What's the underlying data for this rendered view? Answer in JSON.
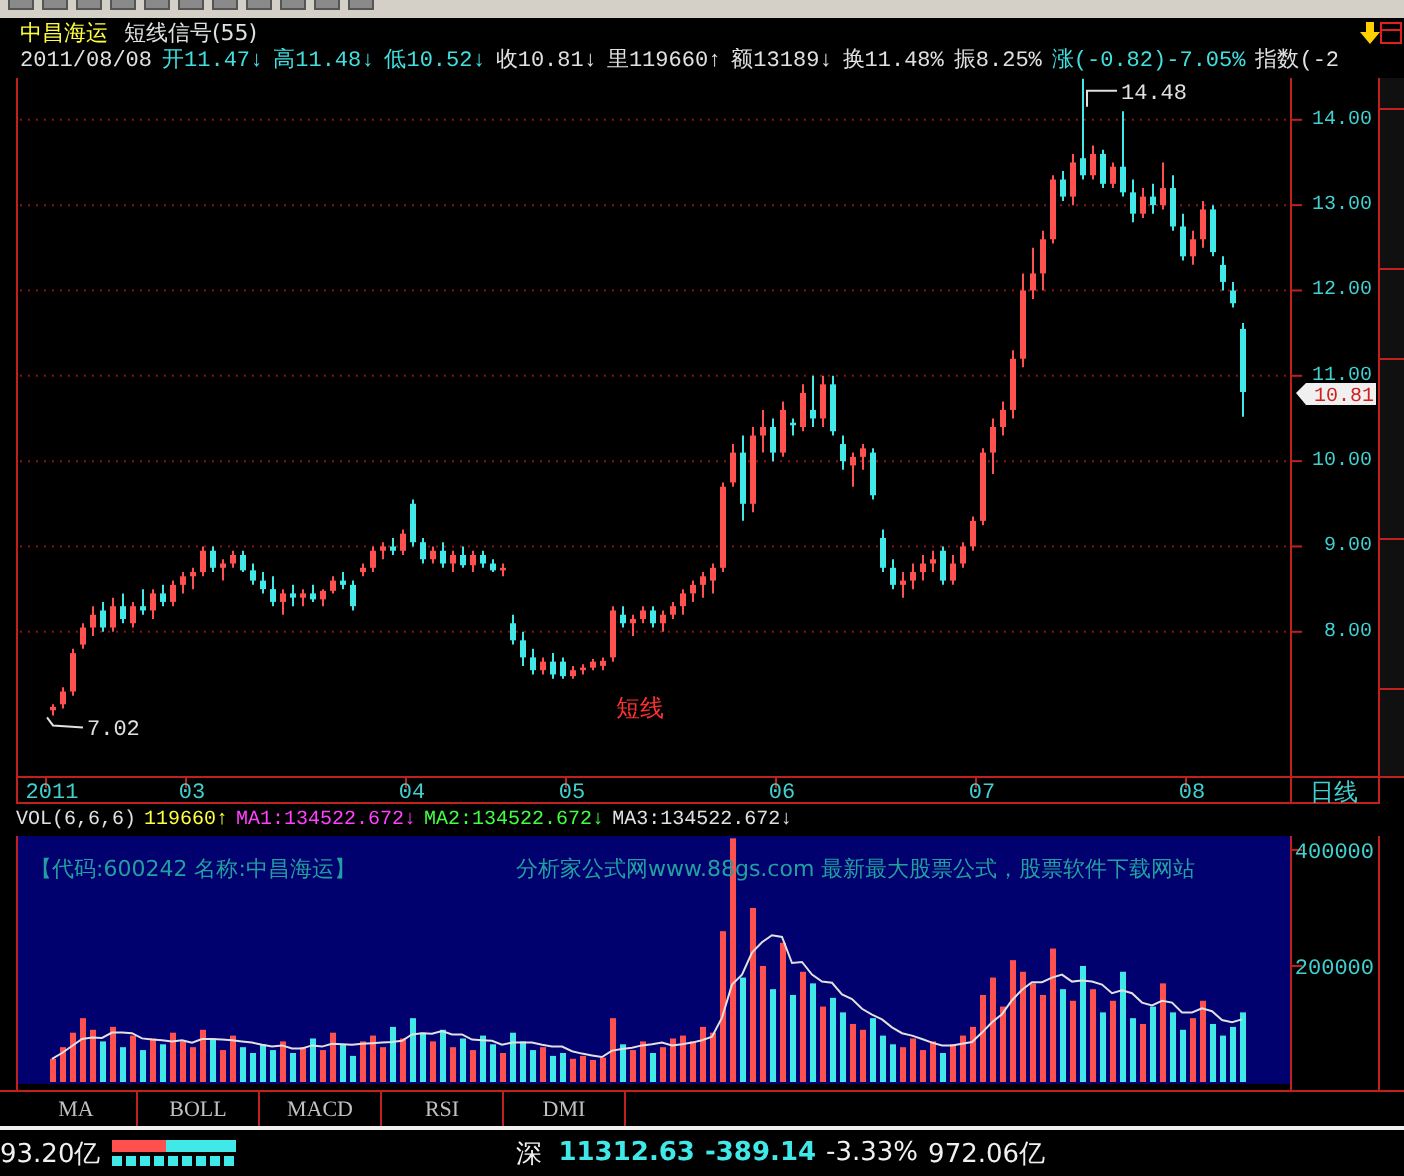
{
  "header": {
    "stock_name": "中昌海运",
    "indicator": "短线信号(55)"
  },
  "quote_line": [
    {
      "text": "2011/08/08",
      "color": "#e0e0e0"
    },
    {
      "text": "开11.47↓",
      "color": "#40e0e0"
    },
    {
      "text": "高11.48↓",
      "color": "#40e0e0"
    },
    {
      "text": "低10.52↓",
      "color": "#40e0e0"
    },
    {
      "text": "收10.81↓",
      "color": "#e0e0e0"
    },
    {
      "text": "里119660↑",
      "color": "#e0e0e0"
    },
    {
      "text": "额13189↓",
      "color": "#e0e0e0"
    },
    {
      "text": "换11.48%",
      "color": "#e0e0e0"
    },
    {
      "text": "振8.25%",
      "color": "#e0e0e0"
    },
    {
      "text": "涨(-0.82)-7.05%",
      "color": "#40e0e0"
    },
    {
      "text": "指数(-2",
      "color": "#e0e0e0"
    }
  ],
  "price_chart": {
    "chart_data": {
      "type": "candlestick",
      "ohlc": [
        [
          7.08,
          7.15,
          7.02,
          7.12
        ],
        [
          7.15,
          7.35,
          7.1,
          7.3
        ],
        [
          7.3,
          7.8,
          7.25,
          7.75
        ],
        [
          7.85,
          8.1,
          7.8,
          8.05
        ],
        [
          8.05,
          8.3,
          7.95,
          8.2
        ],
        [
          8.25,
          8.35,
          8.0,
          8.05
        ],
        [
          8.05,
          8.4,
          8.0,
          8.3
        ],
        [
          8.3,
          8.45,
          8.1,
          8.15
        ],
        [
          8.1,
          8.35,
          8.05,
          8.3
        ],
        [
          8.3,
          8.5,
          8.2,
          8.25
        ],
        [
          8.25,
          8.5,
          8.15,
          8.45
        ],
        [
          8.45,
          8.55,
          8.3,
          8.35
        ],
        [
          8.35,
          8.6,
          8.3,
          8.55
        ],
        [
          8.55,
          8.7,
          8.45,
          8.65
        ],
        [
          8.65,
          8.75,
          8.5,
          8.7
        ],
        [
          8.7,
          9.0,
          8.65,
          8.95
        ],
        [
          8.95,
          9.0,
          8.7,
          8.75
        ],
        [
          8.75,
          8.85,
          8.6,
          8.8
        ],
        [
          8.8,
          8.95,
          8.75,
          8.9
        ],
        [
          8.9,
          8.95,
          8.7,
          8.72
        ],
        [
          8.72,
          8.8,
          8.55,
          8.6
        ],
        [
          8.6,
          8.7,
          8.45,
          8.5
        ],
        [
          8.5,
          8.65,
          8.3,
          8.35
        ],
        [
          8.35,
          8.5,
          8.2,
          8.45
        ],
        [
          8.45,
          8.55,
          8.3,
          8.4
        ],
        [
          8.4,
          8.5,
          8.3,
          8.45
        ],
        [
          8.45,
          8.55,
          8.35,
          8.38
        ],
        [
          8.38,
          8.5,
          8.3,
          8.48
        ],
        [
          8.48,
          8.65,
          8.45,
          8.6
        ],
        [
          8.6,
          8.7,
          8.5,
          8.55
        ],
        [
          8.55,
          8.6,
          8.25,
          8.3
        ],
        [
          8.7,
          8.8,
          8.65,
          8.75
        ],
        [
          8.75,
          9.0,
          8.7,
          8.95
        ],
        [
          8.95,
          9.05,
          8.85,
          9.0
        ],
        [
          9.0,
          9.1,
          8.9,
          8.95
        ],
        [
          8.95,
          9.2,
          8.9,
          9.15
        ],
        [
          9.5,
          9.55,
          9.0,
          9.05
        ],
        [
          9.05,
          9.1,
          8.8,
          8.85
        ],
        [
          8.85,
          9.0,
          8.8,
          8.95
        ],
        [
          8.95,
          9.05,
          8.75,
          8.8
        ],
        [
          8.8,
          8.95,
          8.7,
          8.9
        ],
        [
          8.9,
          9.0,
          8.75,
          8.78
        ],
        [
          8.78,
          8.95,
          8.7,
          8.9
        ],
        [
          8.9,
          8.95,
          8.75,
          8.8
        ],
        [
          8.8,
          8.85,
          8.7,
          8.72
        ],
        [
          8.72,
          8.8,
          8.65,
          8.75
        ],
        [
          8.1,
          8.2,
          7.85,
          7.9
        ],
        [
          7.9,
          8.0,
          7.6,
          7.7
        ],
        [
          7.7,
          7.8,
          7.5,
          7.55
        ],
        [
          7.55,
          7.7,
          7.5,
          7.65
        ],
        [
          7.65,
          7.75,
          7.45,
          7.5
        ],
        [
          7.65,
          7.7,
          7.45,
          7.48
        ],
        [
          7.48,
          7.6,
          7.45,
          7.55
        ],
        [
          7.55,
          7.62,
          7.5,
          7.58
        ],
        [
          7.58,
          7.68,
          7.55,
          7.65
        ],
        [
          7.6,
          7.7,
          7.55,
          7.66
        ],
        [
          7.7,
          8.3,
          7.65,
          8.25
        ],
        [
          8.2,
          8.3,
          8.05,
          8.1
        ],
        [
          8.1,
          8.2,
          7.95,
          8.15
        ],
        [
          8.15,
          8.3,
          8.1,
          8.25
        ],
        [
          8.25,
          8.3,
          8.05,
          8.1
        ],
        [
          8.1,
          8.25,
          8.0,
          8.2
        ],
        [
          8.2,
          8.35,
          8.15,
          8.3
        ],
        [
          8.3,
          8.5,
          8.2,
          8.45
        ],
        [
          8.45,
          8.6,
          8.35,
          8.55
        ],
        [
          8.55,
          8.7,
          8.4,
          8.65
        ],
        [
          8.6,
          8.8,
          8.45,
          8.75
        ],
        [
          8.75,
          9.75,
          8.7,
          9.7
        ],
        [
          9.75,
          10.2,
          9.7,
          10.1
        ],
        [
          10.1,
          10.3,
          9.3,
          9.5
        ],
        [
          9.5,
          10.4,
          9.4,
          10.3
        ],
        [
          10.3,
          10.6,
          10.1,
          10.4
        ],
        [
          10.4,
          10.5,
          10.0,
          10.1
        ],
        [
          10.1,
          10.7,
          10.05,
          10.6
        ],
        [
          10.45,
          10.5,
          10.3,
          10.42
        ],
        [
          10.4,
          10.9,
          10.35,
          10.8
        ],
        [
          10.6,
          11.0,
          10.4,
          10.5
        ],
        [
          10.5,
          11.0,
          10.4,
          10.9
        ],
        [
          10.9,
          11.0,
          10.3,
          10.35
        ],
        [
          10.2,
          10.3,
          9.9,
          10.0
        ],
        [
          9.95,
          10.1,
          9.7,
          10.05
        ],
        [
          10.05,
          10.2,
          9.9,
          10.15
        ],
        [
          10.1,
          10.15,
          9.55,
          9.6
        ],
        [
          9.1,
          9.2,
          8.7,
          8.75
        ],
        [
          8.75,
          8.85,
          8.5,
          8.55
        ],
        [
          8.55,
          8.7,
          8.4,
          8.6
        ],
        [
          8.6,
          8.8,
          8.5,
          8.7
        ],
        [
          8.7,
          8.9,
          8.6,
          8.8
        ],
        [
          8.8,
          8.95,
          8.7,
          8.85
        ],
        [
          8.95,
          9.0,
          8.55,
          8.6
        ],
        [
          8.6,
          8.9,
          8.55,
          8.8
        ],
        [
          8.8,
          9.05,
          8.75,
          9.0
        ],
        [
          9.0,
          9.35,
          8.95,
          9.3
        ],
        [
          9.3,
          10.15,
          9.25,
          10.1
        ],
        [
          10.1,
          10.5,
          9.85,
          10.4
        ],
        [
          10.4,
          10.7,
          10.3,
          10.6
        ],
        [
          10.6,
          11.3,
          10.5,
          11.2
        ],
        [
          11.2,
          12.2,
          11.1,
          12.0
        ],
        [
          12.0,
          12.5,
          11.9,
          12.2
        ],
        [
          12.2,
          12.7,
          12.0,
          12.6
        ],
        [
          12.6,
          13.35,
          12.55,
          13.3
        ],
        [
          13.3,
          13.4,
          13.05,
          13.1
        ],
        [
          13.1,
          13.6,
          13.0,
          13.5
        ],
        [
          13.55,
          14.48,
          13.3,
          13.35
        ],
        [
          13.35,
          13.7,
          13.3,
          13.6
        ],
        [
          13.6,
          13.65,
          13.2,
          13.25
        ],
        [
          13.25,
          13.5,
          13.2,
          13.45
        ],
        [
          13.45,
          14.1,
          13.1,
          13.15
        ],
        [
          13.15,
          13.3,
          12.8,
          12.9
        ],
        [
          12.9,
          13.2,
          12.85,
          13.1
        ],
        [
          13.1,
          13.25,
          12.9,
          13.0
        ],
        [
          13.0,
          13.5,
          12.95,
          13.2
        ],
        [
          13.2,
          13.35,
          12.7,
          12.75
        ],
        [
          12.75,
          12.9,
          12.35,
          12.4
        ],
        [
          12.4,
          12.7,
          12.3,
          12.6
        ],
        [
          12.6,
          13.05,
          12.5,
          12.95
        ],
        [
          12.95,
          13.0,
          12.4,
          12.45
        ],
        [
          12.3,
          12.4,
          12.0,
          12.1
        ],
        [
          12.0,
          12.1,
          11.8,
          11.85
        ],
        [
          11.55,
          11.62,
          10.52,
          10.81
        ]
      ],
      "categories": [
        "2011",
        null,
        null,
        null,
        null,
        null,
        null,
        null,
        null,
        null,
        null,
        null,
        null,
        null,
        "03",
        null,
        null,
        null,
        null,
        null,
        null,
        null,
        null,
        null,
        null,
        null,
        null,
        null,
        null,
        null,
        null,
        null,
        null,
        null,
        null,
        null,
        "04",
        null,
        null,
        null,
        null,
        null,
        null,
        null,
        null,
        null,
        null,
        null,
        null,
        null,
        null,
        null,
        "05",
        null,
        null,
        null,
        null,
        null,
        null,
        null,
        null,
        null,
        null,
        null,
        null,
        null,
        null,
        null,
        null,
        null,
        null,
        null,
        null,
        "06",
        null,
        null,
        null,
        null,
        null,
        null,
        null,
        null,
        null,
        null,
        null,
        null,
        null,
        null,
        null,
        null,
        null,
        null,
        null,
        "07",
        null,
        null,
        null,
        null,
        null,
        null,
        null,
        null,
        null,
        null,
        null,
        null,
        null,
        null,
        null,
        null,
        null,
        null,
        null,
        null,
        "08",
        null,
        null,
        null,
        null,
        null
      ],
      "ylim": [
        6.31,
        14.49
      ],
      "grid": true,
      "yticks": [
        {
          "value": 14,
          "label": "14.00"
        },
        {
          "value": 13,
          "label": "13.00"
        },
        {
          "value": 12,
          "label": "12.00"
        },
        {
          "value": 11,
          "label": "11.00"
        },
        {
          "value": 10,
          "label": "10.00"
        },
        {
          "value": 9,
          "label": "9.00"
        },
        {
          "value": 8,
          "label": "8.00"
        }
      ]
    },
    "current_price": "10.81",
    "high_label": "14.48",
    "low_label": "7.02",
    "signal_label": "短线",
    "period": "日线"
  },
  "volume_header": [
    {
      "text": "VOL(6,6,6)",
      "color": "#e0e0e0"
    },
    {
      "text": "119660↑",
      "color": "#ffff40"
    },
    {
      "text": "MA1:134522.672↓",
      "color": "#ff40ff"
    },
    {
      "text": "MA2:134522.672↓",
      "color": "#40ff40"
    },
    {
      "text": "MA3:134522.672↓",
      "color": "#e0e0e0"
    }
  ],
  "volume_chart": {
    "chart_data": {
      "type": "bar",
      "categories": [
        null,
        null,
        null,
        null,
        null,
        null,
        null,
        null,
        null,
        null,
        null,
        null,
        null,
        null,
        null,
        null,
        null,
        null,
        null,
        null,
        null,
        null,
        null,
        null,
        null,
        null,
        null,
        null,
        null,
        null,
        null,
        null,
        null,
        null,
        null,
        null,
        null,
        null,
        null,
        null,
        null,
        null,
        null,
        null,
        null,
        null,
        null,
        null,
        null,
        null,
        null,
        null,
        null,
        null,
        null,
        null,
        null,
        null,
        null,
        null,
        null,
        null,
        null,
        null,
        null,
        null,
        null,
        null,
        null,
        null,
        null,
        null,
        null,
        null,
        null,
        null,
        null,
        null,
        null,
        null,
        null,
        null,
        null,
        null,
        null,
        null,
        null,
        null,
        null,
        null,
        null,
        null,
        null,
        null,
        null,
        null,
        null,
        null,
        null,
        null,
        null,
        null,
        null,
        null,
        null,
        null,
        null,
        null,
        null,
        null,
        null,
        null,
        null,
        null,
        null,
        null,
        null,
        null,
        null,
        null
      ],
      "ylim": [
        0,
        424000
      ],
      "series": [
        {
          "colors": [
            "#ff5050",
            "#ff5050",
            "#ff5050",
            "#ff5050",
            "#ff5050",
            "#40e8e8",
            "#ff5050",
            "#40e8e8",
            "#ff5050",
            "#40e8e8",
            "#ff5050",
            "#40e8e8",
            "#ff5050",
            "#ff5050",
            "#ff5050",
            "#ff5050",
            "#40e8e8",
            "#ff5050",
            "#ff5050",
            "#40e8e8",
            "#40e8e8",
            "#40e8e8",
            "#40e8e8",
            "#ff5050",
            "#40e8e8",
            "#ff5050",
            "#40e8e8",
            "#ff5050",
            "#ff5050",
            "#40e8e8",
            "#40e8e8",
            "#ff5050",
            "#ff5050",
            "#ff5050",
            "#40e8e8",
            "#ff5050",
            "#40e8e8",
            "#40e8e8",
            "#ff5050",
            "#40e8e8",
            "#ff5050",
            "#40e8e8",
            "#ff5050",
            "#40e8e8",
            "#40e8e8",
            "#ff5050",
            "#40e8e8",
            "#40e8e8",
            "#40e8e8",
            "#ff5050",
            "#40e8e8",
            "#40e8e8",
            "#ff5050",
            "#ff5050",
            "#ff5050",
            "#ff5050",
            "#ff5050",
            "#40e8e8",
            "#ff5050",
            "#ff5050",
            "#40e8e8",
            "#ff5050",
            "#ff5050",
            "#ff5050",
            "#ff5050",
            "#ff5050",
            "#ff5050",
            "#ff5050",
            "#ff5050",
            "#40e8e8",
            "#ff5050",
            "#ff5050",
            "#40e8e8",
            "#ff5050",
            "#40e8e8",
            "#ff5050",
            "#40e8e8",
            "#ff5050",
            "#40e8e8",
            "#40e8e8",
            "#ff5050",
            "#ff5050",
            "#40e8e8",
            "#40e8e8",
            "#40e8e8",
            "#ff5050",
            "#ff5050",
            "#ff5050",
            "#ff5050",
            "#40e8e8",
            "#ff5050",
            "#ff5050",
            "#ff5050",
            "#ff5050",
            "#ff5050",
            "#ff5050",
            "#ff5050",
            "#ff5050",
            "#ff5050",
            "#ff5050",
            "#ff5050",
            "#40e8e8",
            "#ff5050",
            "#40e8e8",
            "#ff5050",
            "#40e8e8",
            "#ff5050",
            "#40e8e8",
            "#40e8e8",
            "#ff5050",
            "#40e8e8",
            "#ff5050",
            "#40e8e8",
            "#40e8e8",
            "#ff5050",
            "#ff5050",
            "#40e8e8",
            "#40e8e8",
            "#40e8e8",
            "#40e8e8"
          ],
          "values": [
            40000,
            60000,
            85000,
            110000,
            90000,
            70000,
            95000,
            60000,
            80000,
            55000,
            75000,
            65000,
            85000,
            70000,
            60000,
            90000,
            75000,
            55000,
            80000,
            60000,
            50000,
            65000,
            55000,
            70000,
            50000,
            60000,
            75000,
            55000,
            85000,
            65000,
            45000,
            70000,
            80000,
            60000,
            95000,
            75000,
            110000,
            85000,
            70000,
            90000,
            60000,
            75000,
            55000,
            80000,
            65000,
            50000,
            85000,
            70000,
            55000,
            60000,
            45000,
            50000,
            40000,
            45000,
            38000,
            42000,
            110000,
            65000,
            55000,
            70000,
            50000,
            60000,
            75000,
            80000,
            70000,
            95000,
            85000,
            260000,
            420000,
            180000,
            300000,
            200000,
            160000,
            240000,
            150000,
            190000,
            170000,
            130000,
            145000,
            120000,
            100000,
            90000,
            110000,
            80000,
            65000,
            60000,
            75000,
            55000,
            70000,
            50000,
            65000,
            80000,
            95000,
            150000,
            180000,
            130000,
            210000,
            190000,
            170000,
            150000,
            230000,
            160000,
            140000,
            200000,
            160000,
            120000,
            140000,
            190000,
            110000,
            100000,
            130000,
            170000,
            120000,
            90000,
            110000,
            140000,
            100000,
            80000,
            95000,
            120000
          ]
        },
        {
          "type": "line",
          "color": "#e0e0e0",
          "values": [
            40000,
            50000,
            62000,
            74000,
            77000,
            76000,
            85000,
            85000,
            84000,
            75000,
            73000,
            72000,
            70000,
            72000,
            68000,
            74000,
            74000,
            73000,
            72000,
            70000,
            68000,
            64000,
            61000,
            63000,
            58000,
            58000,
            63000,
            61000,
            66000,
            65000,
            64000,
            66000,
            67000,
            68000,
            69000,
            71000,
            82000,
            84000,
            83000,
            88000,
            82000,
            82000,
            73000,
            72000,
            71000,
            64000,
            68000,
            68000,
            68000,
            64000,
            61000,
            61000,
            53000,
            49000,
            46000,
            43000,
            54000,
            57000,
            59000,
            63000,
            65000,
            68000,
            63000,
            65000,
            68000,
            72000,
            78000,
            111000,
            168000,
            185000,
            223000,
            241000,
            253000,
            250000,
            205000,
            207000,
            185000,
            173000,
            171000,
            151000,
            143000,
            126000,
            116000,
            108000,
            94000,
            84000,
            80000,
            74000,
            68000,
            63000,
            63000,
            66000,
            69000,
            85000,
            103000,
            117000,
            141000,
            159000,
            172000,
            172000,
            180000,
            185000,
            173000,
            175000,
            173000,
            168000,
            153000,
            158000,
            153000,
            137000,
            132000,
            140000,
            137000,
            120000,
            120000,
            127000,
            122000,
            107000,
            103000,
            108000
          ]
        }
      ],
      "yticks": [
        {
          "value": 400000,
          "label": "400000"
        },
        {
          "value": 200000,
          "label": "200000"
        }
      ]
    },
    "notes": [
      "【代码:600242 名称:中昌海运】",
      "分析家公式网www.88gs.com 最新最大股票公式，股票软件下载网站"
    ]
  },
  "indicator_tabs": [
    "MA",
    "BOLL",
    "MACD",
    "RSI",
    "DMI"
  ],
  "status_bar": {
    "turnover": "93.20亿",
    "market": "深",
    "index": "11312.63",
    "change": "-389.14",
    "percent": "-3.33%",
    "amount": "972.06亿"
  }
}
